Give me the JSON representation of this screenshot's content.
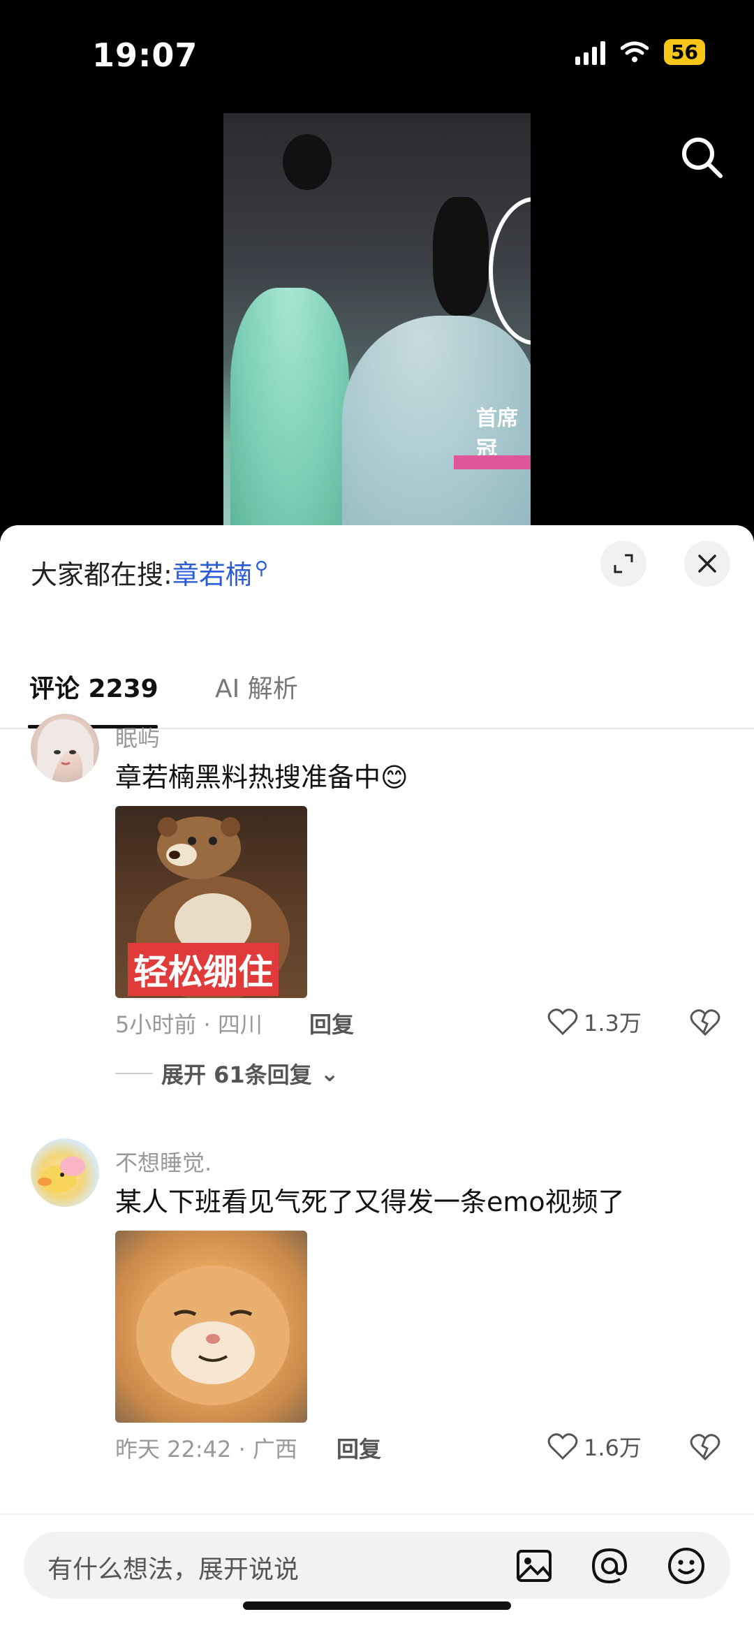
{
  "status_bar": {
    "time": "19:07",
    "battery": "56"
  },
  "video": {
    "overlay_text": "首席冠"
  },
  "sheet": {
    "hot_search_prefix": "大家都在搜:",
    "hot_search_keyword": "章若楠"
  },
  "tabs": [
    {
      "label": "评论 2239",
      "active": true
    },
    {
      "label": "AI 解析",
      "active": false
    }
  ],
  "comments": [
    {
      "username": "眠屿",
      "text": "章若楠黑料热搜准备中😊",
      "image_caption": "轻松绷住",
      "meta": "5小时前 · 四川",
      "reply_label": "回复",
      "likes": "1.3万",
      "expand_label": "展开 61条回复"
    },
    {
      "username": "不想睡觉.",
      "text": "某人下班看见气死了又得发一条emo视频了",
      "meta": "昨天 22:42 · 广西",
      "reply_label": "回复",
      "likes": "1.6万"
    }
  ],
  "composer": {
    "placeholder": "有什么想法，展开说说"
  },
  "colors": {
    "accent": "#2a5bd7",
    "battery": "#f5c518"
  }
}
